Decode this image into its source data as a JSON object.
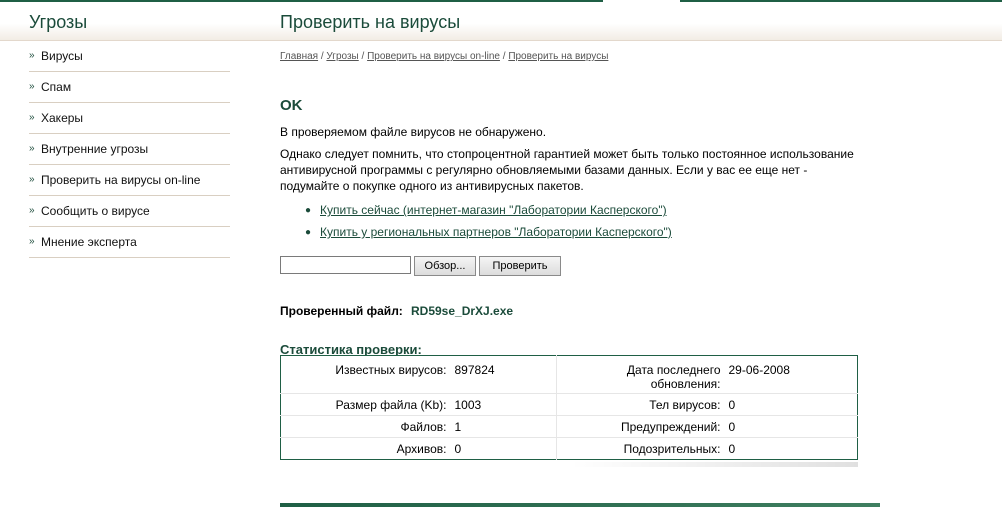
{
  "header": {
    "sidebar_title": "Угрозы",
    "page_title": "Проверить на вирусы"
  },
  "sidebar": {
    "items": [
      {
        "label": "Вирусы"
      },
      {
        "label": "Спам"
      },
      {
        "label": "Хакеры"
      },
      {
        "label": "Внутренние угрозы"
      },
      {
        "label": "Проверить на вирусы on-line"
      },
      {
        "label": "Сообщить о вирусе"
      },
      {
        "label": "Мнение эксперта"
      }
    ]
  },
  "breadcrumb": {
    "items": [
      "Главная",
      "Угрозы",
      "Проверить на вирусы on-line",
      "Проверить на вирусы"
    ],
    "separator": "/"
  },
  "result": {
    "status": "OK",
    "message": "В проверяемом файле вирусов не обнаружено.",
    "note": "Однако следует помнить, что стопроцентной гарантией может быть только постоянное использование антивирусной программы с регулярно обновляемыми базами данных. Если у вас ее еще нет - подумайте о покупке одного из антивирусных пакетов."
  },
  "links": [
    {
      "label": "Купить сейчас (интернет-магазин \"Лаборатории Касперского\")"
    },
    {
      "label": "Купить у региональных партнеров \"Лаборатории Касперского\")"
    }
  ],
  "upload": {
    "file_value": "",
    "browse_label": "Обзор...",
    "check_label": "Проверить"
  },
  "checked_file": {
    "label": "Проверенный файл:",
    "value": "RD59se_DrXJ.exe"
  },
  "stats": {
    "title": "Статистика проверки:",
    "rows": [
      {
        "k1": "Известных вирусов:",
        "v1": "897824",
        "k2": "Дата последнего обновления:",
        "v2": "29-06-2008"
      },
      {
        "k1": "Размер файла (Kb):",
        "v1": "1003",
        "k2": "Тел вирусов:",
        "v2": "0"
      },
      {
        "k1": "Файлов:",
        "v1": "1",
        "k2": "Предупреждений:",
        "v2": "0"
      },
      {
        "k1": "Архивов:",
        "v1": "0",
        "k2": "Подозрительных:",
        "v2": "0"
      }
    ]
  },
  "colors": {
    "accent": "#1b4b3a",
    "border": "#1f5f45",
    "divider": "#d9cfc2"
  }
}
